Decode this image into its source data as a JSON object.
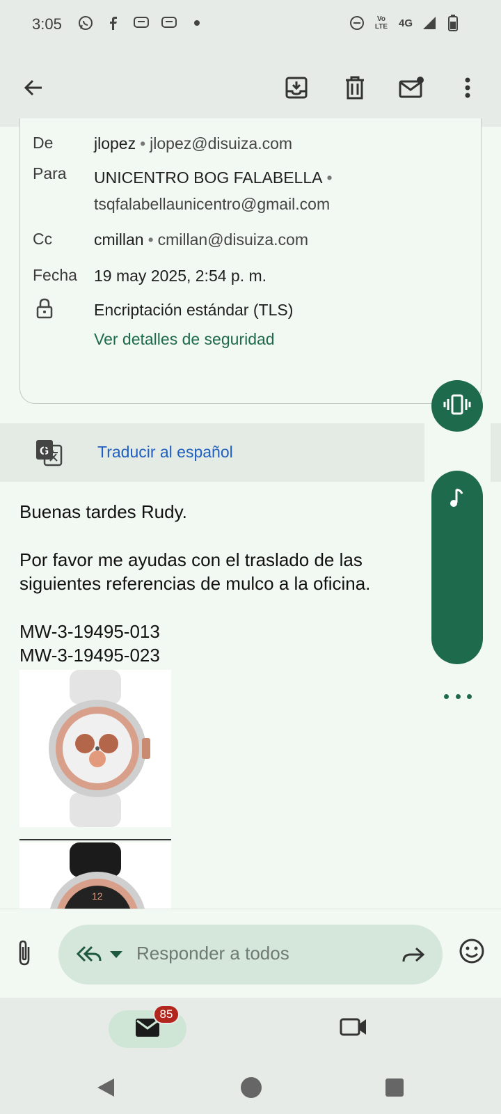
{
  "status_bar": {
    "time": "3:05",
    "left_icons": [
      "whatsapp-icon",
      "facebook-icon",
      "chat-icon",
      "chat-icon",
      "dot-icon"
    ],
    "right_icons": [
      "dnd-icon",
      "volte-icon",
      "4g-icon",
      "signal-icon",
      "battery-icon"
    ],
    "network": "4G",
    "volte": "Vo LTE"
  },
  "app_bar": {
    "icons": [
      "back-arrow-icon",
      "archive-icon",
      "delete-icon",
      "mark-unread-icon",
      "more-vert-icon"
    ]
  },
  "details": {
    "from_label": "De",
    "from_name": "jlopez",
    "from_email": "jlopez@disuiza.com",
    "to_label": "Para",
    "to_name": "UNICENTRO BOG FALABELLA",
    "to_email": "tsqfalabellaunicentro@gmail.com",
    "cc_label": "Cc",
    "cc_name": "cmillan",
    "cc_email": "cmillan@disuiza.com",
    "date_label": "Fecha",
    "date_value": "19 may 2025, 2:54 p. m.",
    "encryption": "Encriptación estándar (TLS)",
    "security_link": "Ver detalles de seguridad",
    "separator": "•"
  },
  "translate": {
    "link": "Traducir al español"
  },
  "message": {
    "greeting": "Buenas tardes Rudy.",
    "line1": "Por favor me ayudas con el traslado de las",
    "line2": "siguientes referencias de mulco a la oficina.",
    "ref1": "MW-3-19495-013",
    "ref2": "MW-3-19495-023"
  },
  "reply": {
    "placeholder": "Responder a todos"
  },
  "bottom_nav": {
    "mail_badge": "85"
  },
  "colors": {
    "accent": "#1e6a4c",
    "link_blue": "#1f5fbf",
    "badge_red": "#b3261e"
  }
}
